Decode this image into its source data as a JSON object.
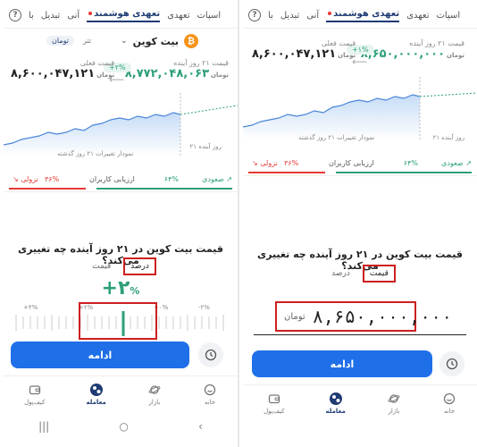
{
  "tabs": {
    "spot": "اسپات",
    "futures": "تعهدی",
    "smart_futures": "تعهدی هوشمند",
    "instant": "آنی",
    "convert": "تبدیل",
    "extra": "با"
  },
  "coin": {
    "name": "بیت کوین",
    "symbol": "₿"
  },
  "units": {
    "toman": "تومان",
    "tether": "تتر"
  },
  "prices": {
    "future_label": "قیمت ۲۱ روز آینده",
    "current_label": "قیمت فعلی",
    "left_future_value": "۸,۷۷۲,۰۴۸,۰۶۳",
    "left_current_value": "۸,۶۰۰,۰۴۷,۱۲۱",
    "left_pct": "+۲%",
    "right_future_value": "۸,۶۵۰,۰۰۰,۰۰۰",
    "right_current_value": "۸,۶۰۰,۰۴۷,۱۲۱",
    "right_pct": "+۱%",
    "unit": "تومان"
  },
  "chart": {
    "caption_future": "۲۱ روز آینده",
    "caption_past": "نمودار تغییرات ۲۱ روز گذشته"
  },
  "sentiment": {
    "down_label": "نزولی",
    "down_pct": "۳۶%",
    "mid_label": "ارزیابی کاربران",
    "up_label": "صعودی",
    "up_pct": "۶۴%"
  },
  "question": "قیمت بیت کوین در ۲۱ روز آینده چه تغییری می‌کند؟",
  "modes": {
    "percent": "درصد",
    "price": "قیمت"
  },
  "selected_change": {
    "sign": "+",
    "value": "۲",
    "unit": "%"
  },
  "ruler": {
    "ticks": [
      "+۴%",
      "+۲%",
      "+۰%",
      "-۲%"
    ]
  },
  "price_input": {
    "value": "۸,۶۵۰,۰۰۰,۰۰۰",
    "unit": "تومان"
  },
  "continue_label": "ادامه",
  "bottom_nav": {
    "home": "خانه",
    "market": "بازار",
    "trade": "معامله",
    "wallet": "کیف‌پول"
  },
  "colors": {
    "accent": "#1f6fe8",
    "up": "#2e9f7a",
    "down": "#e53935",
    "highlight": "#cc1f1f"
  }
}
